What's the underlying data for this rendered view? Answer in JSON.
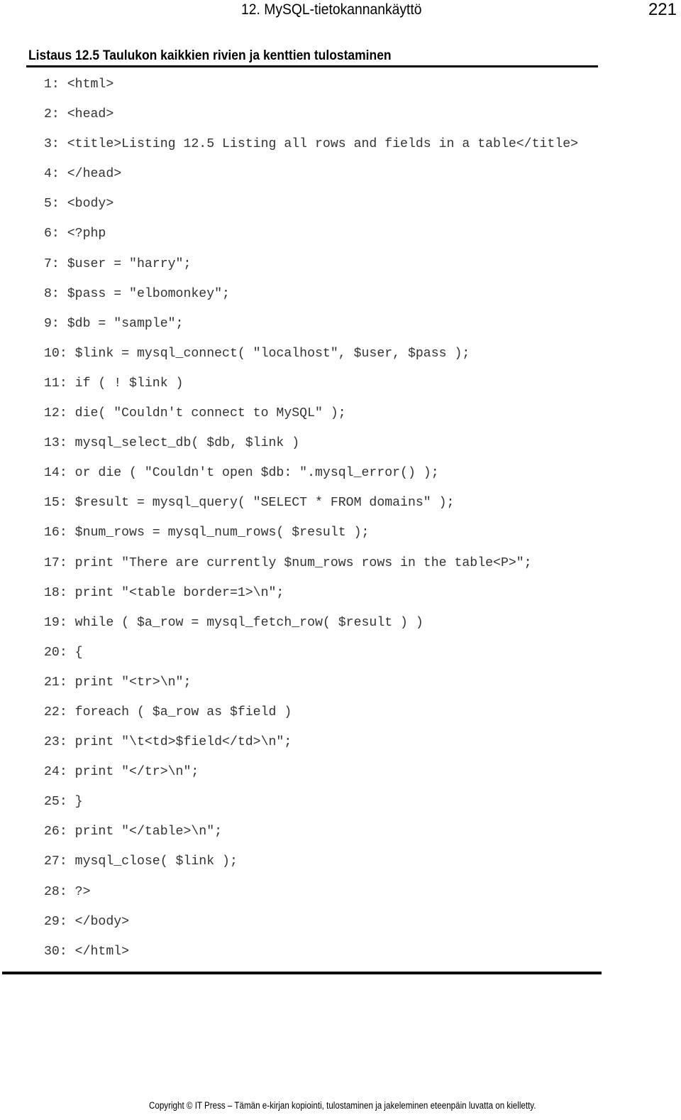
{
  "header": {
    "chapter_title": "12. MySQL-tietokannankäyttö",
    "page_number": "221"
  },
  "listing": {
    "title": "Listaus 12.5 Taulukon kaikkien rivien ja kenttien tulostaminen",
    "lines": [
      "1: <html>",
      "2: <head>",
      "3: <title>Listing 12.5 Listing all rows and fields in a table</title>",
      "4: </head>",
      "5: <body>",
      "6: <?php",
      "7: $user = \"harry\";",
      "8: $pass = \"elbomonkey\";",
      "9: $db = \"sample\";",
      "10: $link = mysql_connect( \"localhost\", $user, $pass );",
      "11: if ( ! $link )",
      "12: die( \"Couldn't connect to MySQL\" );",
      "13: mysql_select_db( $db, $link )",
      "14: or die ( \"Couldn't open $db: \".mysql_error() );",
      "15: $result = mysql_query( \"SELECT * FROM domains\" );",
      "16: $num_rows = mysql_num_rows( $result );",
      "17: print \"There are currently $num_rows rows in the table<P>\";",
      "18: print \"<table border=1>\\n\";",
      "19: while ( $a_row = mysql_fetch_row( $result ) )",
      "20: {",
      "21: print \"<tr>\\n\";",
      "22: foreach ( $a_row as $field )",
      "23: print \"\\t<td>$field</td>\\n\";",
      "24: print \"</tr>\\n\";",
      "25: }",
      "26: print \"</table>\\n\";",
      "27: mysql_close( $link );",
      "28: ?>",
      "29: </body>",
      "30: </html>"
    ]
  },
  "footer": {
    "copyright": "Copyright © IT Press – Tämän e-kirjan kopiointi, tulostaminen ja jakeleminen eteenpäin luvatta on kielletty."
  }
}
